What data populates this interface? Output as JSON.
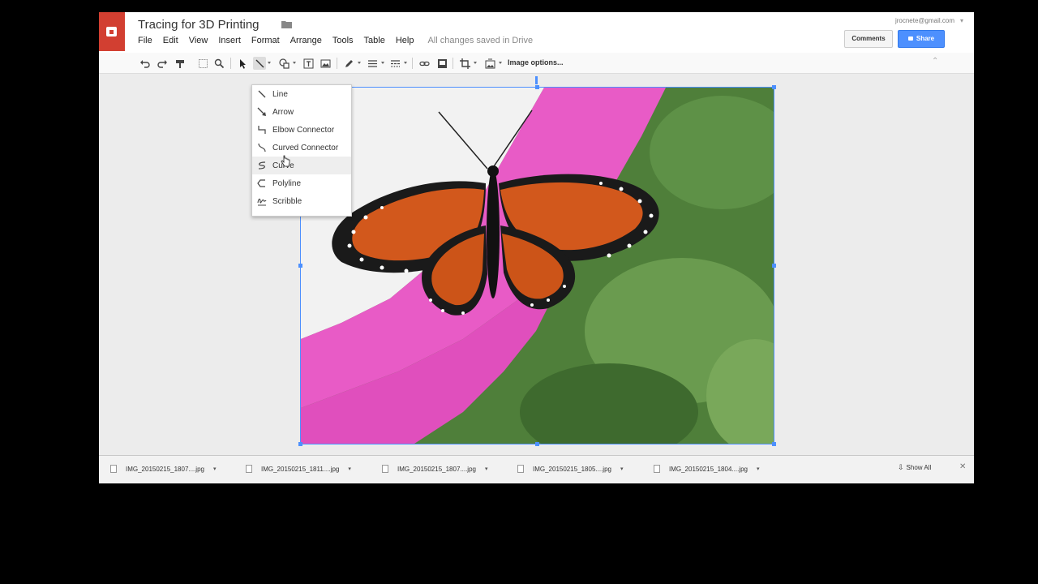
{
  "document": {
    "title": "Tracing for 3D Printing",
    "save_status": "All changes saved in Drive"
  },
  "menubar": [
    "File",
    "Edit",
    "View",
    "Insert",
    "Format",
    "Arrange",
    "Tools",
    "Table",
    "Help"
  ],
  "account": {
    "email": "jrocnete@gmail.com",
    "comments_label": "Comments",
    "share_label": "Share"
  },
  "toolbar": {
    "image_options_label": "Image options...",
    "icons": [
      "undo-icon",
      "redo-icon",
      "paint-format-icon",
      "select-icon",
      "zoom-icon",
      "pointer-icon",
      "line-icon",
      "shape-icon",
      "textbox-icon",
      "image-icon",
      "pen-icon",
      "line-weight-icon",
      "line-dash-icon",
      "link-icon",
      "comment-icon",
      "crop-icon",
      "replace-image-icon",
      "collapse-icon"
    ]
  },
  "line_menu": {
    "items": [
      {
        "label": "Line",
        "icon": "line-icon"
      },
      {
        "label": "Arrow",
        "icon": "arrow-icon"
      },
      {
        "label": "Elbow Connector",
        "icon": "elbow-connector-icon"
      },
      {
        "label": "Curved Connector",
        "icon": "curved-connector-icon"
      },
      {
        "label": "Curve",
        "icon": "curve-icon"
      },
      {
        "label": "Polyline",
        "icon": "polyline-icon"
      },
      {
        "label": "Scribble",
        "icon": "scribble-icon"
      }
    ],
    "hovered": "Curve"
  },
  "downloads": {
    "files": [
      "IMG_20150215_1807....jpg",
      "IMG_20150215_1811....jpg",
      "IMG_20150215_1807....jpg",
      "IMG_20150215_1805....jpg",
      "IMG_20150215_1804....jpg"
    ],
    "show_all_label": "Show All"
  },
  "colors": {
    "brand_red": "#d23f31",
    "share_blue": "#4d90fe",
    "selection_blue": "#4d90fe"
  }
}
